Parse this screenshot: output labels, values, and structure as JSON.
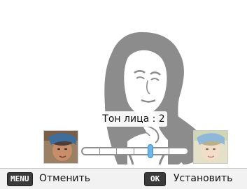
{
  "adjustment": {
    "label": "Тон лица : 2",
    "value": 2,
    "slider_position": 0.64
  },
  "thumbnails": {
    "left_icon": "darker-skin-preview",
    "right_icon": "lighter-skin-preview"
  },
  "footer": {
    "menu_key": "MENU",
    "cancel_label": "Отменить",
    "ok_key": "OK",
    "set_label": "Установить"
  },
  "colors": {
    "silhouette": "#8c8c8c",
    "slider_handle": "#6bb6ea",
    "key_badge": "#3a3a3a"
  }
}
